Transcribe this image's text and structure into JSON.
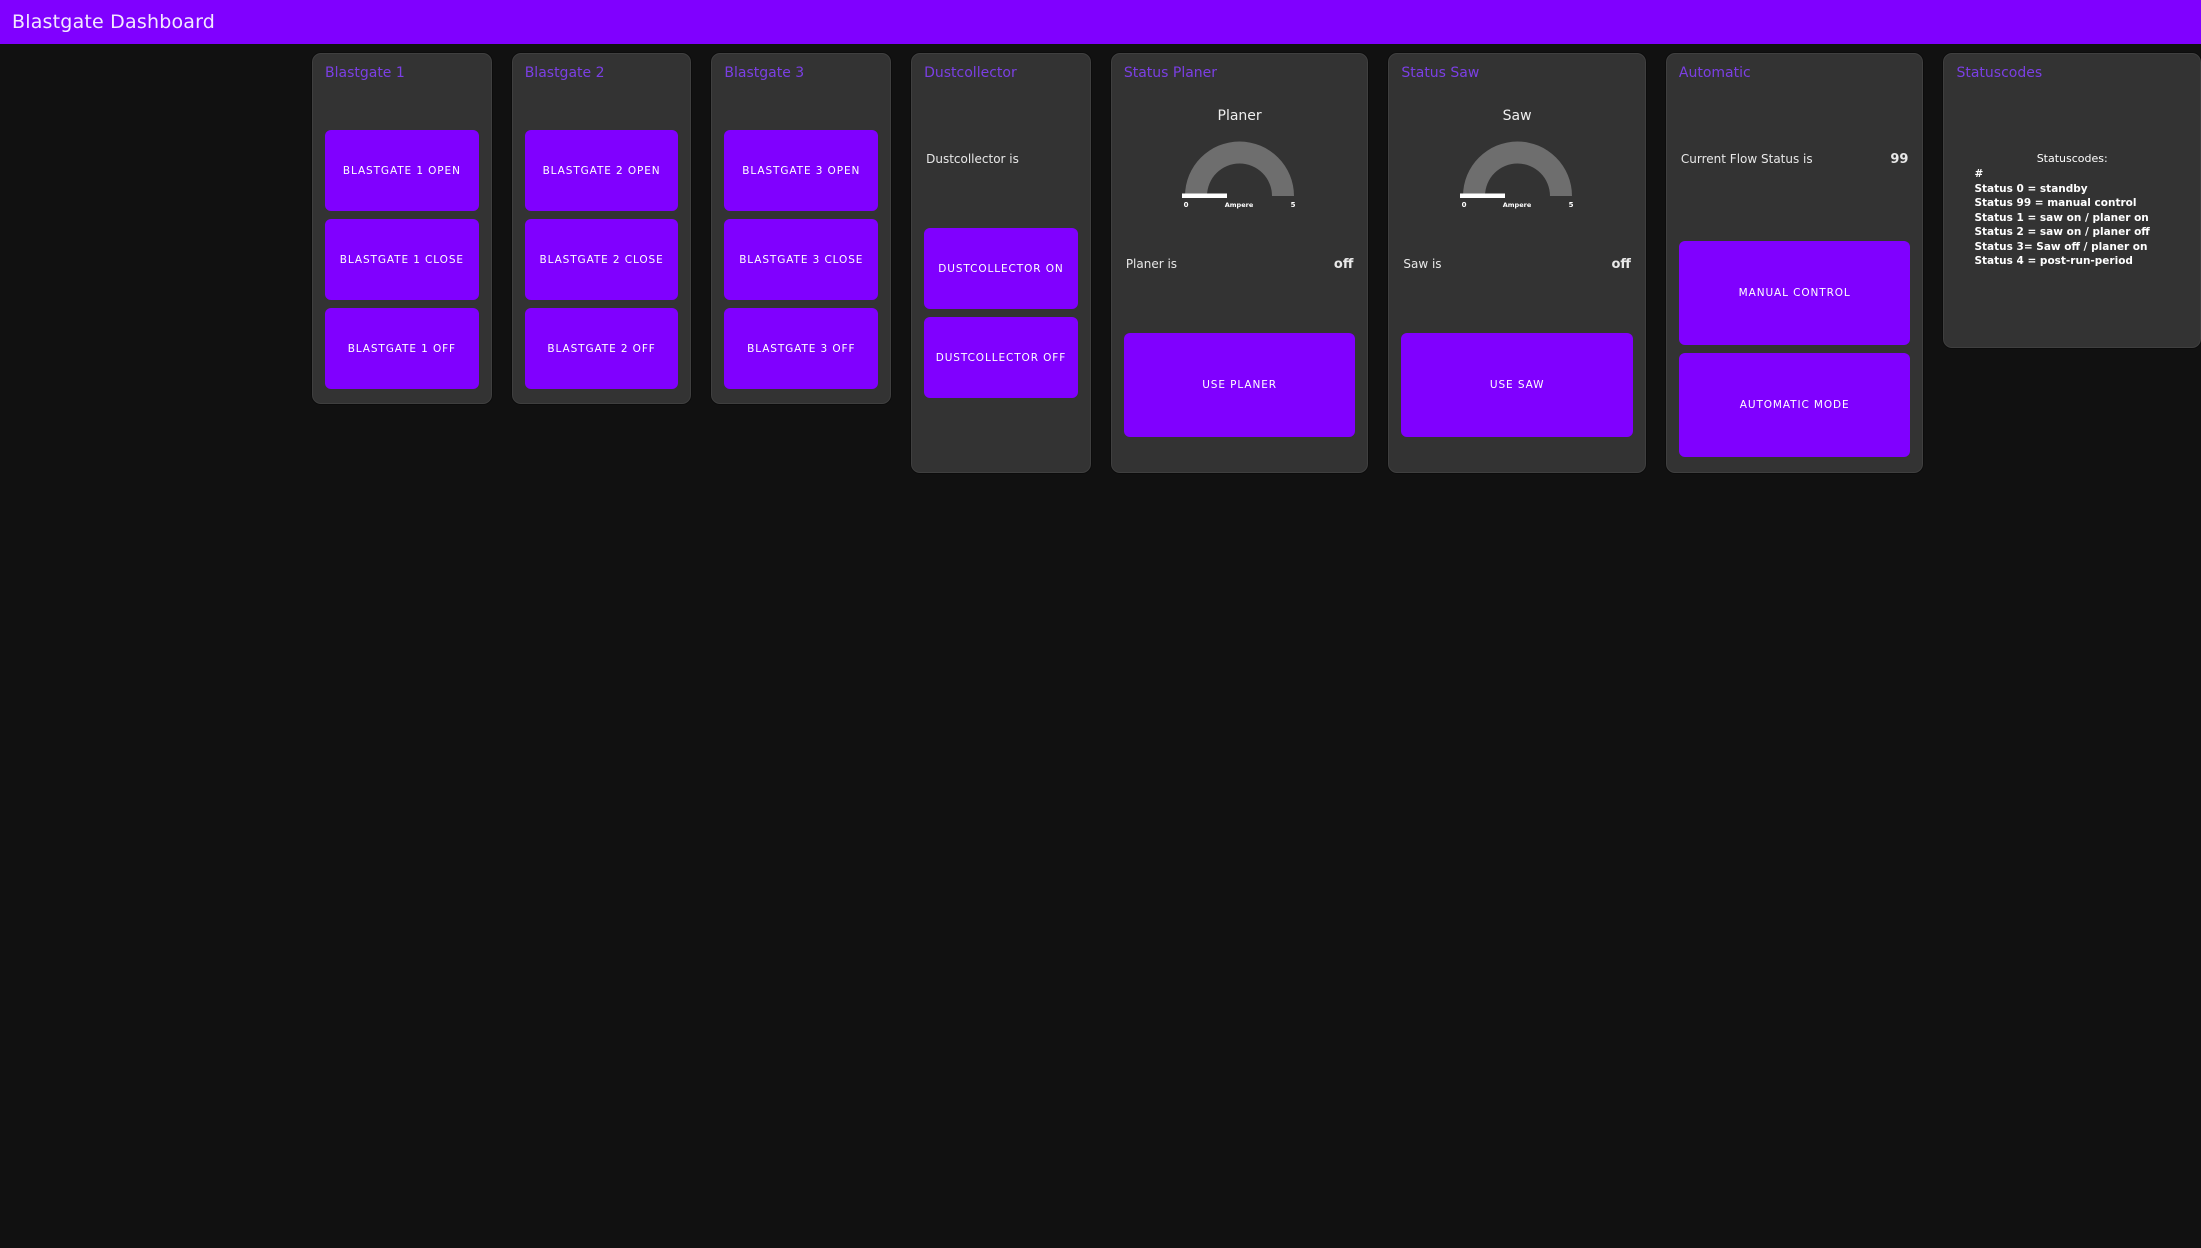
{
  "appbar": {
    "title": "Blastgate Dashboard",
    "bar_color": "#8000FF",
    "title_color": "#F2E8FF"
  },
  "theme": {
    "page_background": "#111111",
    "card_background": "#333333",
    "card_title_color": "#7B3FE4",
    "button_color": "#8000FF",
    "button_text_color": "#FFFFFF",
    "gauge_arc_color": "#6E6E6E",
    "gauge_needle_color": "#FFFFFF"
  },
  "cards": {
    "blastgate1": {
      "title": "Blastgate 1",
      "buttons": [
        {
          "label": "BLASTGATE 1 OPEN",
          "name": "blastgate-1-open-button"
        },
        {
          "label": "BLASTGATE 1 CLOSE",
          "name": "blastgate-1-close-button"
        },
        {
          "label": "BLASTGATE 1 OFF",
          "name": "blastgate-1-off-button"
        }
      ]
    },
    "blastgate2": {
      "title": "Blastgate 2",
      "buttons": [
        {
          "label": "BLASTGATE 2 OPEN",
          "name": "blastgate-2-open-button"
        },
        {
          "label": "BLASTGATE 2 CLOSE",
          "name": "blastgate-2-close-button"
        },
        {
          "label": "BLASTGATE 2 OFF",
          "name": "blastgate-2-off-button"
        }
      ]
    },
    "blastgate3": {
      "title": "Blastgate 3",
      "buttons": [
        {
          "label": "BLASTGATE 3 OPEN",
          "name": "blastgate-3-open-button"
        },
        {
          "label": "BLASTGATE 3 CLOSE",
          "name": "blastgate-3-close-button"
        },
        {
          "label": "BLASTGATE 3 OFF",
          "name": "blastgate-3-off-button"
        }
      ]
    },
    "dustcollector": {
      "title": "Dustcollector",
      "status_label": "Dustcollector is",
      "status_value": "",
      "buttons": [
        {
          "label": "DUSTCOLLECTOR ON",
          "name": "dustcollector-on-button"
        },
        {
          "label": "DUSTCOLLECTOR OFF",
          "name": "dustcollector-off-button"
        }
      ]
    },
    "status_planer": {
      "title": "Status Planer",
      "gauge": {
        "name": "Planer",
        "unit": "Ampere",
        "min_label": "0",
        "max_label": "5",
        "min": 0,
        "max": 5,
        "value": 0
      },
      "status_label": "Planer is",
      "status_value": "off",
      "button": {
        "label": "USE PLANER",
        "name": "use-planer-button"
      }
    },
    "status_saw": {
      "title": "Status Saw",
      "gauge": {
        "name": "Saw",
        "unit": "Ampere",
        "min_label": "0",
        "max_label": "5",
        "min": 0,
        "max": 5,
        "value": 0
      },
      "status_label": "Saw is",
      "status_value": "off",
      "button": {
        "label": "USE SAW",
        "name": "use-saw-button"
      }
    },
    "automatic": {
      "title": "Automatic",
      "status_label": "Current Flow Status is",
      "status_value": "99",
      "buttons": [
        {
          "label": "MANUAL CONTROL",
          "name": "manual-control-button"
        },
        {
          "label": "AUTOMATIC MODE",
          "name": "automatic-mode-button"
        }
      ]
    },
    "statuscodes": {
      "title": "Statuscodes",
      "heading": "Statuscodes:",
      "lines": [
        "#",
        "Status 0 = standby",
        "Status 99 = manual control",
        "Status 1 = saw on / planer on",
        "Status 2 = saw on / planer off",
        "Status 3= Saw off / planer on",
        "Status 4 = post-run-period"
      ]
    }
  }
}
